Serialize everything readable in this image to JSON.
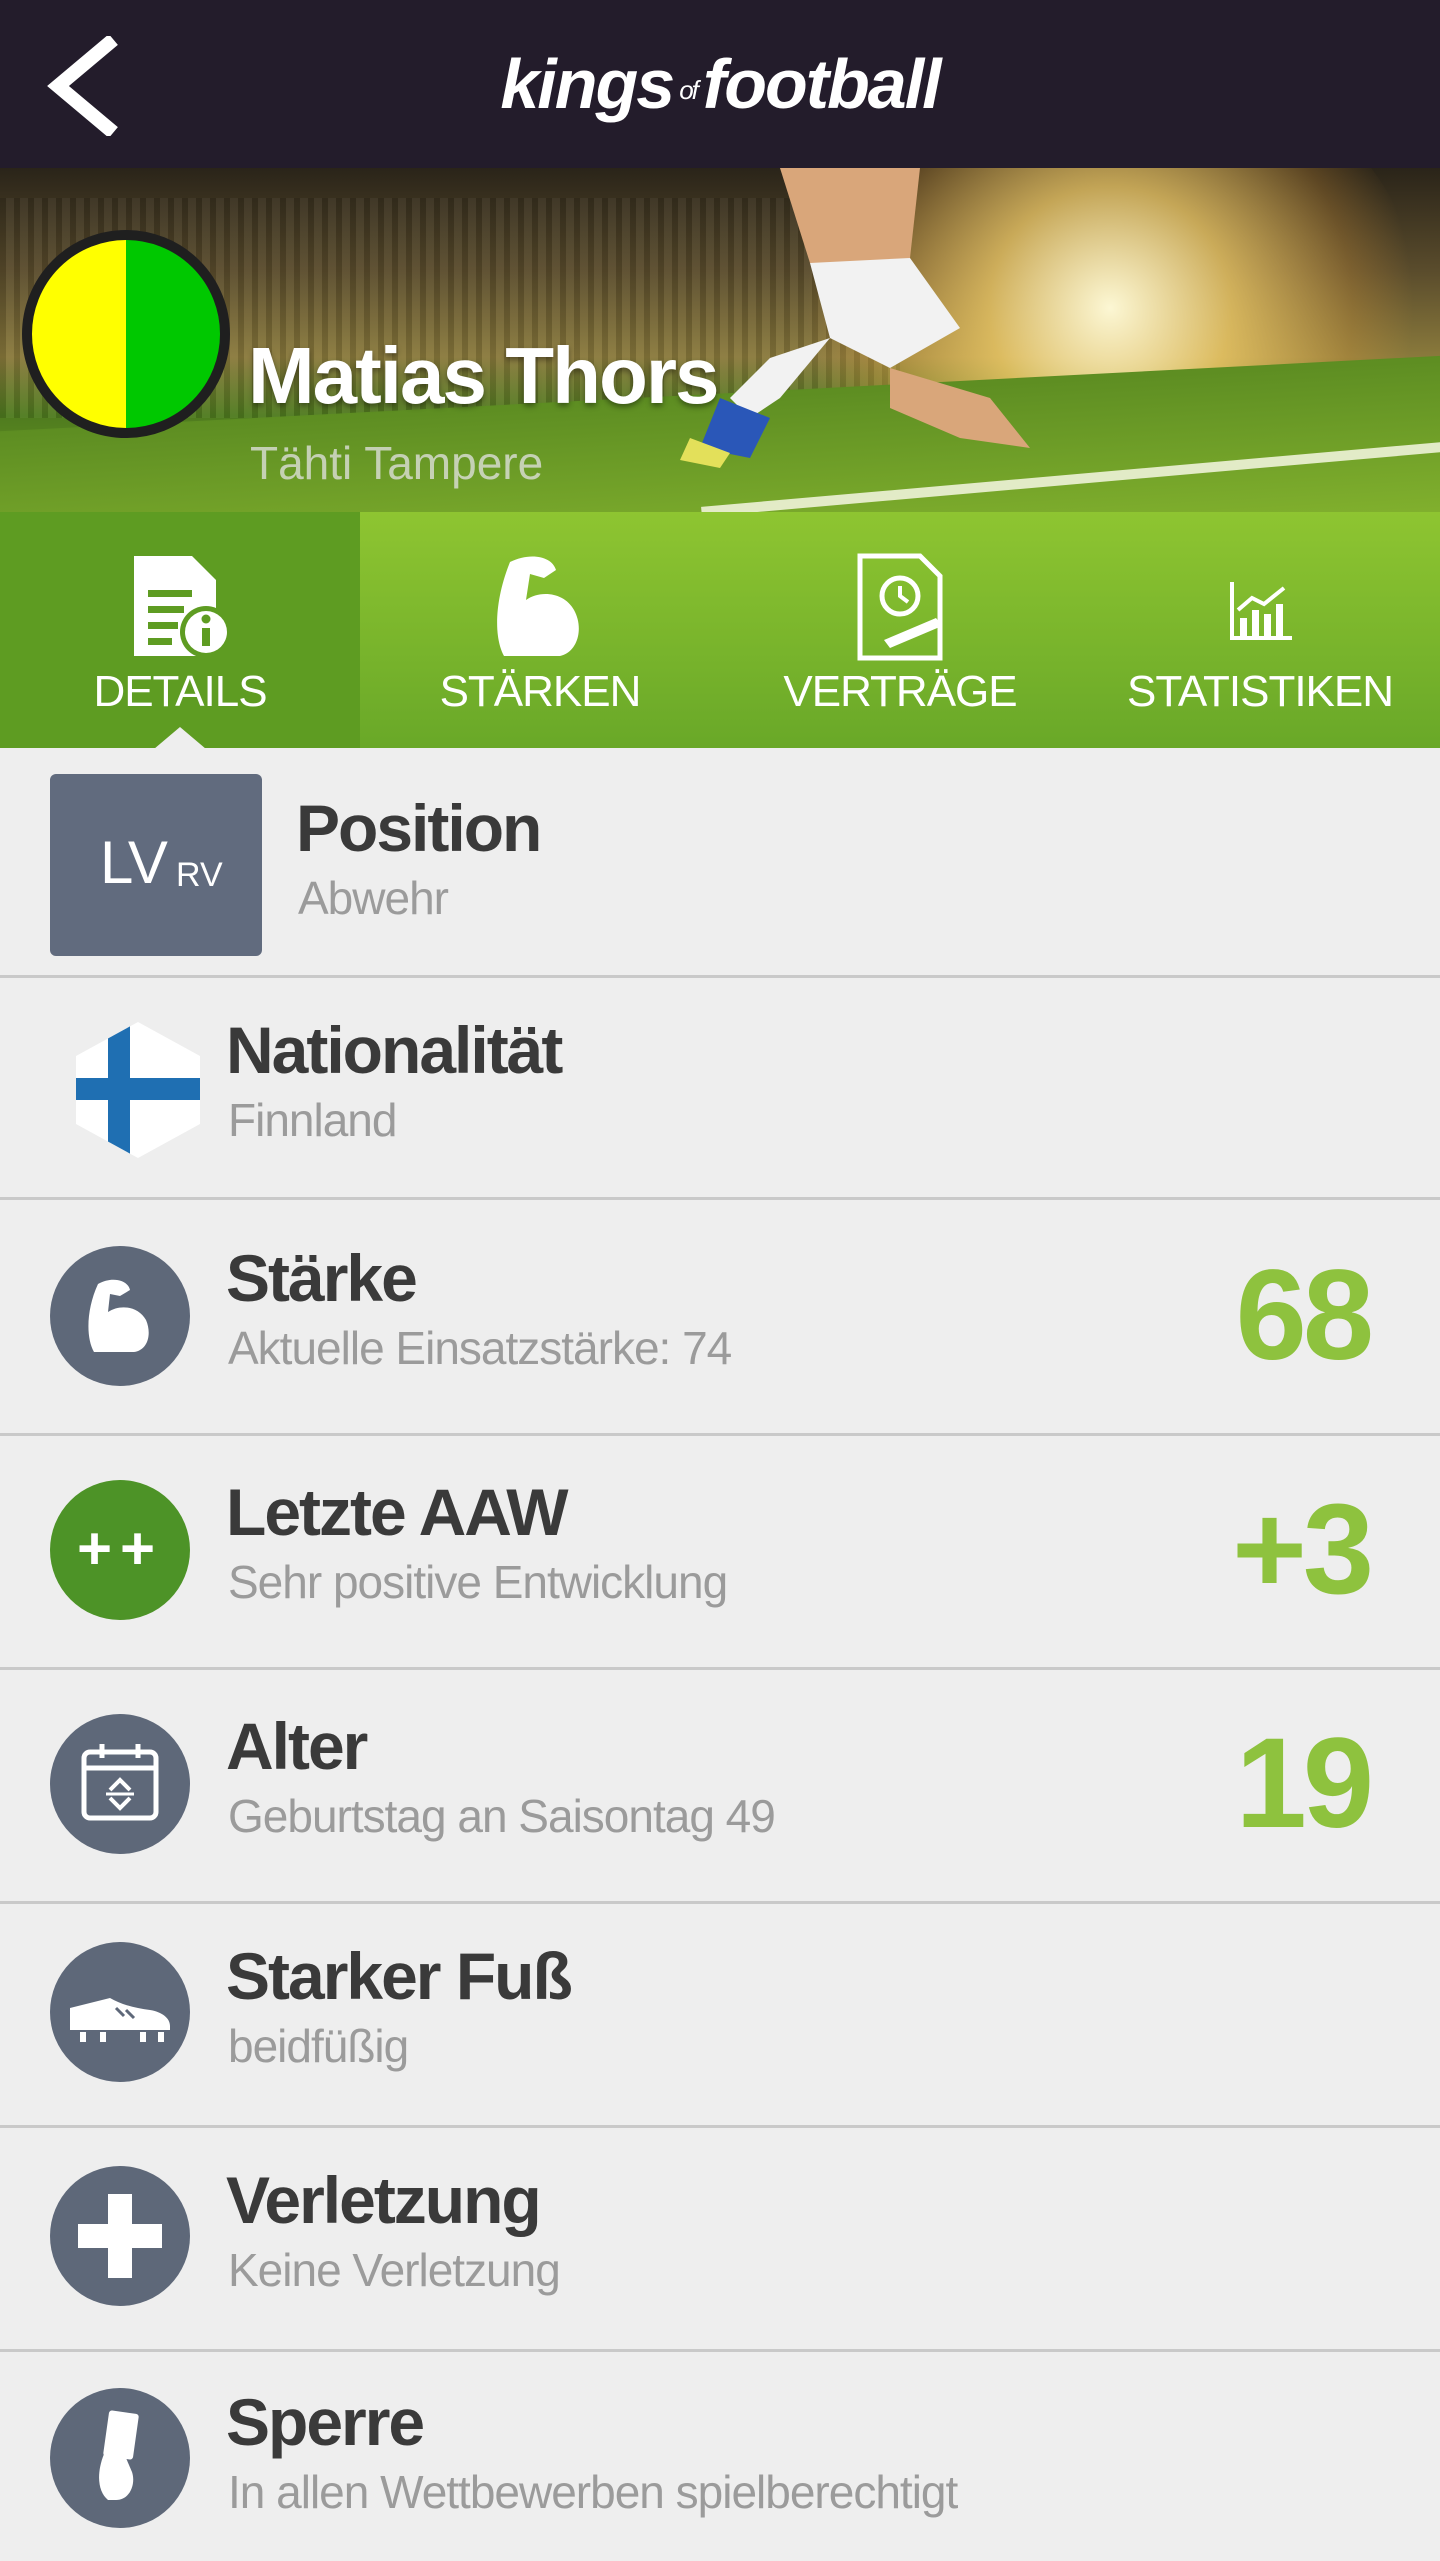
{
  "header": {
    "logo_left": "kings",
    "logo_of": "of",
    "logo_right": "football",
    "back_icon": "chevron-left-icon"
  },
  "hero": {
    "player_name": "Matias Thors",
    "club_name": "Tähti Tampere",
    "club_colors": [
      "#ffff00",
      "#00c800"
    ]
  },
  "tabs": [
    {
      "label": "DETAILS",
      "icon": "document-info-icon",
      "active": true
    },
    {
      "label": "STÄRKEN",
      "icon": "flexed-arm-icon",
      "active": false
    },
    {
      "label": "VERTRÄGE",
      "icon": "contract-icon",
      "active": false
    },
    {
      "label": "STATISTIKEN",
      "icon": "chart-icon",
      "active": false
    }
  ],
  "rows": {
    "position": {
      "title": "Position",
      "sub": "Abwehr",
      "main": "LV",
      "alt": "RV"
    },
    "nationality": {
      "title": "Nationalität",
      "sub": "Finnland",
      "icon": "finland-flag-icon"
    },
    "strength": {
      "title": "Stärke",
      "sub": "Aktuelle Einsatzstärke: 74",
      "value": "68",
      "icon": "flexed-arm-icon"
    },
    "last_aaw": {
      "title": "Letzte AAW",
      "sub": "Sehr positive Entwicklung",
      "value": "+3",
      "icon_text": "++"
    },
    "age": {
      "title": "Alter",
      "sub": "Geburtstag an Saisontag 49",
      "value": "19",
      "icon": "calendar-icon"
    },
    "foot": {
      "title": "Starker Fuß",
      "sub": "beidfüßig",
      "icon": "football-boot-icon"
    },
    "injury": {
      "title": "Verletzung",
      "sub": "Keine Verletzung",
      "icon": "medical-cross-icon"
    },
    "suspension": {
      "title": "Sperre",
      "sub": "In allen Wettbewerben spielberechtigt",
      "icon": "card-hand-icon"
    }
  },
  "colors": {
    "topbar": "#231c2b",
    "tab_green": "#7ab82c",
    "value_green": "#8ec23e",
    "icon_grey": "#5e6879"
  }
}
